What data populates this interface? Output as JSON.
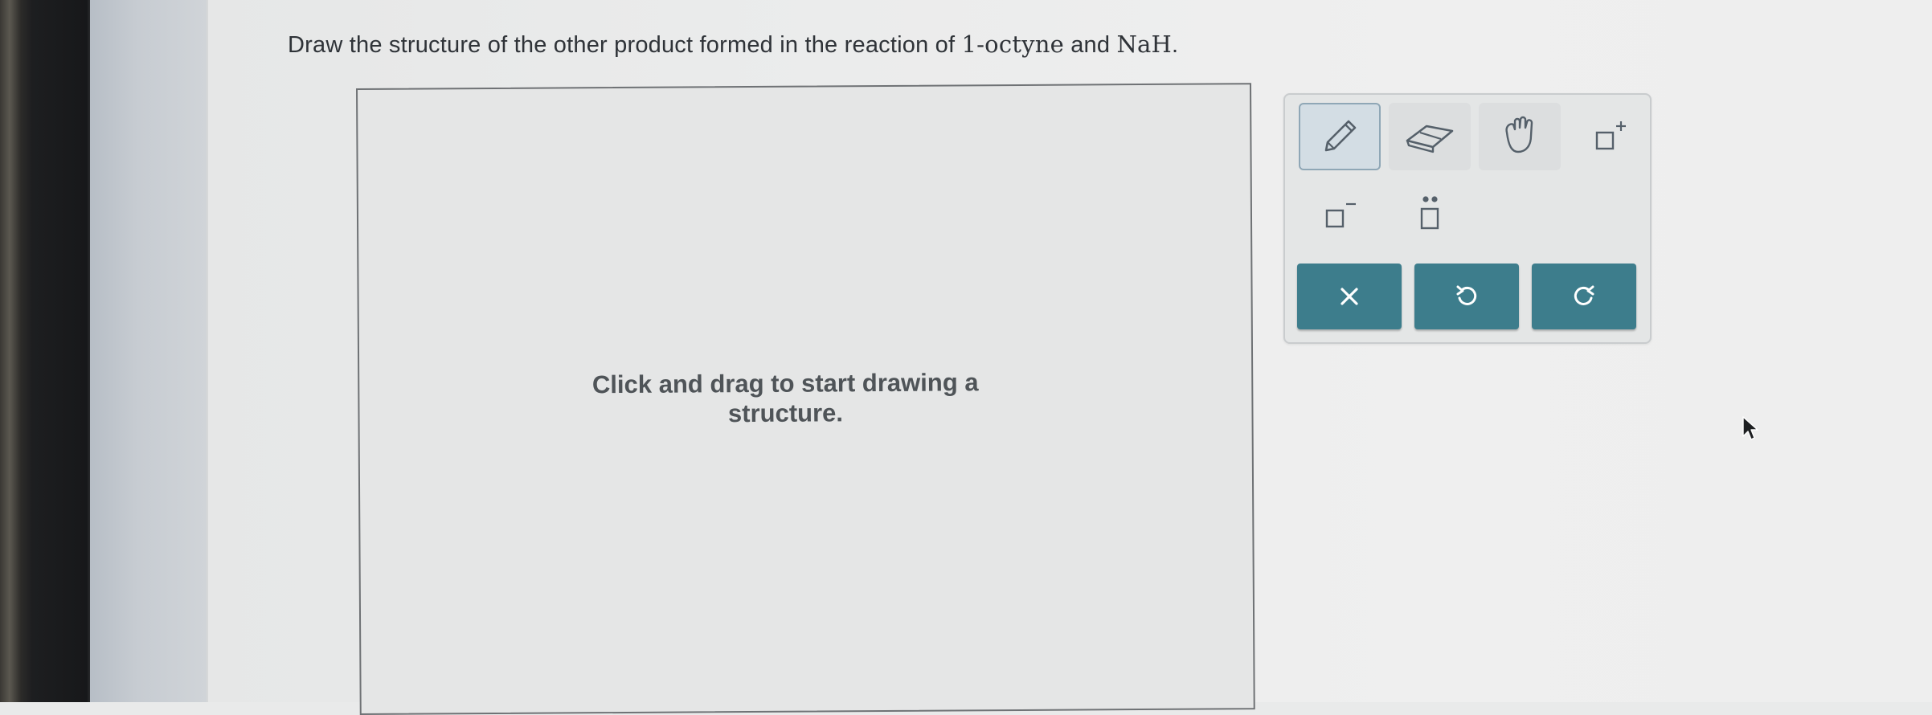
{
  "question": {
    "prefix": "Draw the structure of the other product formed in the reaction of ",
    "reagent1": "1-octyne",
    "middle": " and ",
    "reagent2": "NaH",
    "suffix": "."
  },
  "canvas": {
    "prompt_line1": "Click and drag to start drawing a",
    "prompt_line2": "structure."
  },
  "toolbar": {
    "tools": [
      "pencil-icon",
      "eraser-icon",
      "hand-icon",
      "positive-charge-icon",
      "negative-charge-icon",
      "lone-pair-icon"
    ],
    "actions": [
      "clear-icon",
      "undo-icon",
      "redo-icon"
    ],
    "action_color": "#3d7d8c"
  }
}
